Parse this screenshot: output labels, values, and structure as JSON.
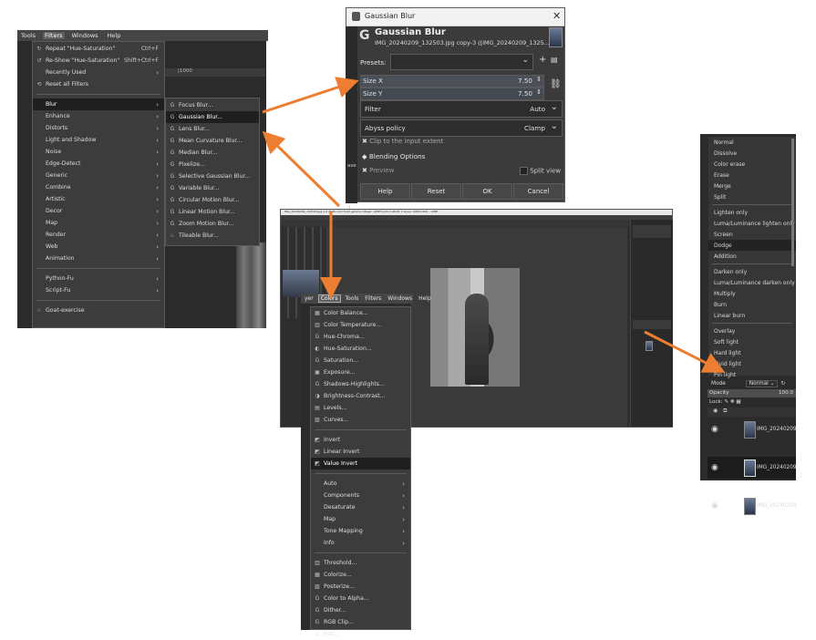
{
  "colors": {
    "arrow": "#ed7d31",
    "menu_bg": "#3c3c3c",
    "dark_bg": "#2b2b2b"
  },
  "filters_panel": {
    "menubar": [
      "Tools",
      "Filters",
      "Windows",
      "Help"
    ],
    "ruler_text": "|1000",
    "items": [
      {
        "label": "Repeat \"Hue-Saturation\"",
        "shortcut": "Ctrl+F",
        "icon": "repeat-icon"
      },
      {
        "label": "Re-Show \"Hue-Saturation\"",
        "shortcut": "Shift+Ctrl+F",
        "icon": "reshow-icon"
      },
      {
        "label": "Recently Used",
        "arrow": true
      },
      {
        "label": "Reset all Filters",
        "icon": "reset-icon"
      }
    ],
    "categories": [
      "Blur",
      "Enhance",
      "Distorts",
      "Light and Shadow",
      "Noise",
      "Edge-Detect",
      "Generic",
      "Combine",
      "Artistic",
      "Decor",
      "Map",
      "Render",
      "Web",
      "Animation"
    ],
    "script_items": [
      "Python-Fu",
      "Script-Fu"
    ],
    "goat": "Goat-exercise",
    "blur_submenu": [
      "Focus Blur...",
      "Gaussian Blur...",
      "Lens Blur...",
      "Mean Curvature Blur...",
      "Median Blur...",
      "Pixelize...",
      "Selective Gaussian Blur...",
      "Variable Blur...",
      "Circular Motion Blur...",
      "Linear Motion Blur...",
      "Zoom Motion Blur...",
      "Tileable Blur..."
    ]
  },
  "gaussian_dialog": {
    "window_title": "Gaussian Blur",
    "heading": "Gaussian Blur",
    "subtitle": "IMG_20240209_132503.jpg copy-3 ([IMG_20240209_1325...",
    "presets_label": "Presets:",
    "size_x_label": "Size X",
    "size_x_value": "7.50",
    "size_y_label": "Size Y",
    "size_y_value": "7.50",
    "filter_label": "Filter",
    "filter_value": "Auto",
    "abyss_label": "Abyss policy",
    "abyss_value": "Clamp",
    "clip_label": "Clip to the input extent",
    "blending_label": "Blending Options",
    "preview_label": "Preview",
    "split_label": "Split view",
    "buttons": {
      "help": "Help",
      "reset": "Reset",
      "ok": "OK",
      "cancel": "Cancel"
    },
    "side_labels": [
      "ase",
      "d La"
    ]
  },
  "gimp_main": {
    "title_bar_text": "IMG_20240209_132503.jpg-1.0 (RGB color 8-bit gamma integer, GIMP built-in sRGB, 1 layer) 1080x1440 – GIMP"
  },
  "colors_menu": {
    "menubar": [
      "yer",
      "Colors",
      "Tools",
      "Filters",
      "Windows",
      "Help"
    ],
    "items": [
      "Color Balance...",
      "Color Temperature...",
      "Hue-Chroma...",
      "Hue-Saturation...",
      "Saturation...",
      "Exposure...",
      "Shadows-Highlights...",
      "Brightness-Contrast...",
      "Levels...",
      "Curves..."
    ],
    "invert_items": [
      "Invert",
      "Linear Invert",
      "Value Invert"
    ],
    "sub_items": [
      "Auto",
      "Components",
      "Desaturate",
      "Map",
      "Tone Mapping",
      "Info"
    ],
    "extra_items": [
      "Threshold...",
      "Colorize...",
      "Posterize...",
      "Color to Alpha...",
      "Dither...",
      "RGB Clip...",
      "Hot..."
    ]
  },
  "blend_panel": {
    "modes": [
      "Normal",
      "Dissolve",
      "Color erase",
      "Erase",
      "Merge",
      "Split",
      "Lighten only",
      "Luma/Luminance lighten only",
      "Screen",
      "Dodge",
      "Addition",
      "Darken only",
      "Luma/Luminance darken only",
      "Multiply",
      "Burn",
      "Linear burn",
      "Overlay",
      "Soft light",
      "Hard light",
      "Vivid light",
      "Pin light"
    ],
    "mode_label": "Mode",
    "mode_value": "Normal",
    "opacity_label": "Opacity",
    "opacity_value": "100.0",
    "lock_label": "Lock:",
    "layers": [
      "IMG_20240209",
      "IMG_20240209",
      "IMG_20240209"
    ]
  }
}
